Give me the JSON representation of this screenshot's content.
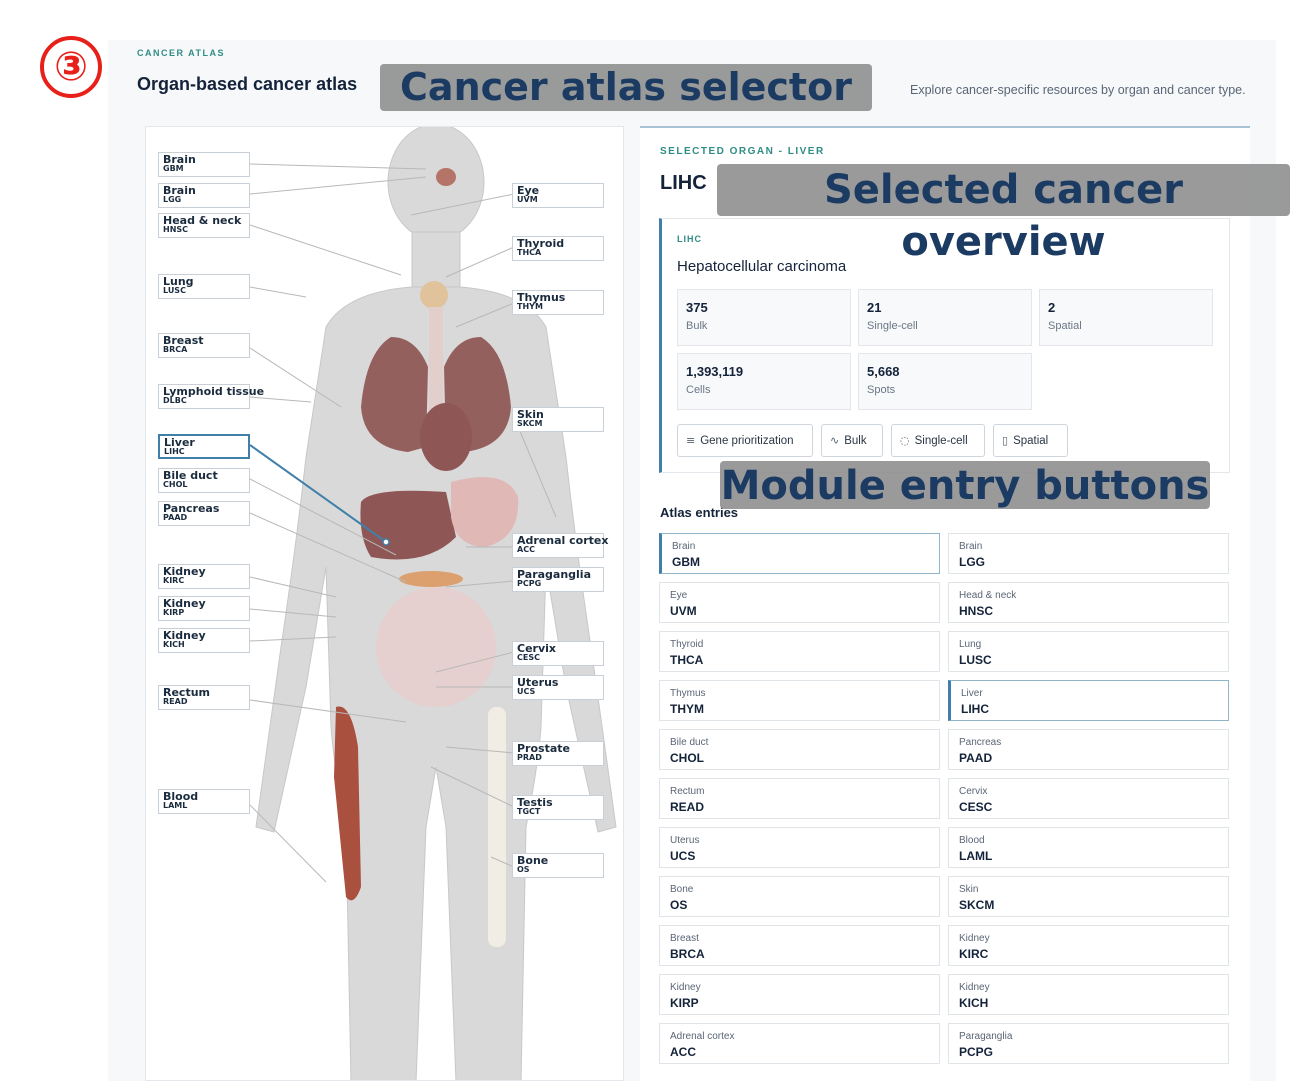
{
  "step_marker": "③",
  "header": {
    "eyebrow": "CANCER ATLAS",
    "title": "Organ-based cancer atlas",
    "subtitle": "Explore cancer-specific resources by organ and cancer type."
  },
  "callouts": {
    "selector": "Cancer atlas selector",
    "overview": "Selected cancer overview",
    "modules": "Module entry buttons"
  },
  "body_map": {
    "left_labels": [
      {
        "name": "Brain",
        "code": "GBM"
      },
      {
        "name": "Brain",
        "code": "LGG"
      },
      {
        "name": "Head & neck",
        "code": "HNSC"
      },
      {
        "name": "Lung",
        "code": "LUSC"
      },
      {
        "name": "Breast",
        "code": "BRCA"
      },
      {
        "name": "Lymphoid tissue",
        "code": "DLBC"
      },
      {
        "name": "Liver",
        "code": "LIHC",
        "active": true
      },
      {
        "name": "Bile duct",
        "code": "CHOL"
      },
      {
        "name": "Pancreas",
        "code": "PAAD"
      },
      {
        "name": "Kidney",
        "code": "KIRC"
      },
      {
        "name": "Kidney",
        "code": "KIRP"
      },
      {
        "name": "Kidney",
        "code": "KICH"
      },
      {
        "name": "Rectum",
        "code": "READ"
      },
      {
        "name": "Blood",
        "code": "LAML"
      }
    ],
    "right_labels": [
      {
        "name": "Eye",
        "code": "UVM"
      },
      {
        "name": "Thyroid",
        "code": "THCA"
      },
      {
        "name": "Thymus",
        "code": "THYM"
      },
      {
        "name": "Skin",
        "code": "SKCM"
      },
      {
        "name": "Adrenal cortex",
        "code": "ACC"
      },
      {
        "name": "Paraganglia",
        "code": "PCPG"
      },
      {
        "name": "Cervix",
        "code": "CESC"
      },
      {
        "name": "Uterus",
        "code": "UCS"
      },
      {
        "name": "Prostate",
        "code": "PRAD"
      },
      {
        "name": "Testis",
        "code": "TGCT"
      },
      {
        "name": "Bone",
        "code": "OS"
      }
    ]
  },
  "selected": {
    "eyebrow": "SELECTED ORGAN - LIVER",
    "code": "LIHC",
    "card_eyebrow": "LIHC",
    "name": "Hepatocellular carcinoma",
    "stats": [
      {
        "value": "375",
        "label": "Bulk"
      },
      {
        "value": "21",
        "label": "Single-cell"
      },
      {
        "value": "2",
        "label": "Spatial"
      },
      {
        "value": "1,393,119",
        "label": "Cells"
      },
      {
        "value": "5,668",
        "label": "Spots"
      }
    ],
    "modules": [
      {
        "label": "Gene prioritization",
        "icon": "list-icon"
      },
      {
        "label": "Bulk",
        "icon": "pulse-icon"
      },
      {
        "label": "Single-cell",
        "icon": "dotted-circle-icon"
      },
      {
        "label": "Spatial",
        "icon": "map-icon"
      }
    ]
  },
  "entries": {
    "title": "Atlas entries",
    "items": [
      {
        "organ": "Brain",
        "code": "GBM",
        "selected": true
      },
      {
        "organ": "Brain",
        "code": "LGG"
      },
      {
        "organ": "Eye",
        "code": "UVM"
      },
      {
        "organ": "Head & neck",
        "code": "HNSC"
      },
      {
        "organ": "Thyroid",
        "code": "THCA"
      },
      {
        "organ": "Lung",
        "code": "LUSC"
      },
      {
        "organ": "Thymus",
        "code": "THYM"
      },
      {
        "organ": "Liver",
        "code": "LIHC",
        "selected": true
      },
      {
        "organ": "Bile duct",
        "code": "CHOL"
      },
      {
        "organ": "Pancreas",
        "code": "PAAD"
      },
      {
        "organ": "Rectum",
        "code": "READ"
      },
      {
        "organ": "Cervix",
        "code": "CESC"
      },
      {
        "organ": "Uterus",
        "code": "UCS"
      },
      {
        "organ": "Blood",
        "code": "LAML"
      },
      {
        "organ": "Bone",
        "code": "OS"
      },
      {
        "organ": "Skin",
        "code": "SKCM"
      },
      {
        "organ": "Breast",
        "code": "BRCA"
      },
      {
        "organ": "Kidney",
        "code": "KIRC"
      },
      {
        "organ": "Kidney",
        "code": "KIRP"
      },
      {
        "organ": "Kidney",
        "code": "KICH"
      },
      {
        "organ": "Adrenal cortex",
        "code": "ACC"
      },
      {
        "organ": "Paraganglia",
        "code": "PCPG"
      }
    ]
  },
  "colors": {
    "accent": "#3f7fa8",
    "eyebrow": "#2f8c84",
    "marker": "#e8201a",
    "callout_text": "#1c3b63"
  }
}
